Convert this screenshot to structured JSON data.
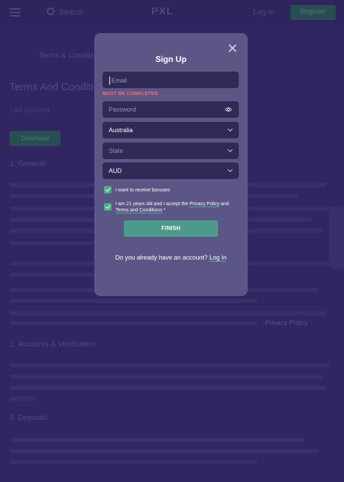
{
  "background": {
    "search_label": "Search",
    "logo_text": "PXL",
    "login_label": "Log In",
    "register_label": "Register",
    "breadcrumb": "Terms & Conditions",
    "title": "Terms And Conditions",
    "date": "Last updated",
    "green_button": "Download",
    "section_1": "1. General",
    "section_2": "2. Accounts & Verification",
    "section_3": "3. Deposits",
    "link_text": "Privacy Policy"
  },
  "modal": {
    "title": "Sign Up",
    "email_placeholder": "Email",
    "email_error": "MUST BE COMPLETED",
    "password_placeholder": "Password",
    "country_value": "Australia",
    "state_placeholder": "State",
    "currency_value": "AUD",
    "bonus_label": "I want to receive bonuses",
    "terms_prefix": "I am 21 years old and I accept the ",
    "privacy_link": "Privacy Policy",
    "terms_and": " and",
    "terms_link": "Terms and Conditions",
    "terms_suffix": " *",
    "finish_label": "FINISH",
    "account_question": "Do you already have an account?",
    "login_link": "Log In"
  },
  "colors": {
    "accent": "#4caf8a",
    "error": "#ff6b6b",
    "modal_bg": "#5b5686",
    "field_bg": "#2f2a56"
  },
  "icons": {
    "close": "close-icon",
    "eye": "eye-icon",
    "chevron": "chevron-down-icon",
    "check": "check-icon"
  }
}
